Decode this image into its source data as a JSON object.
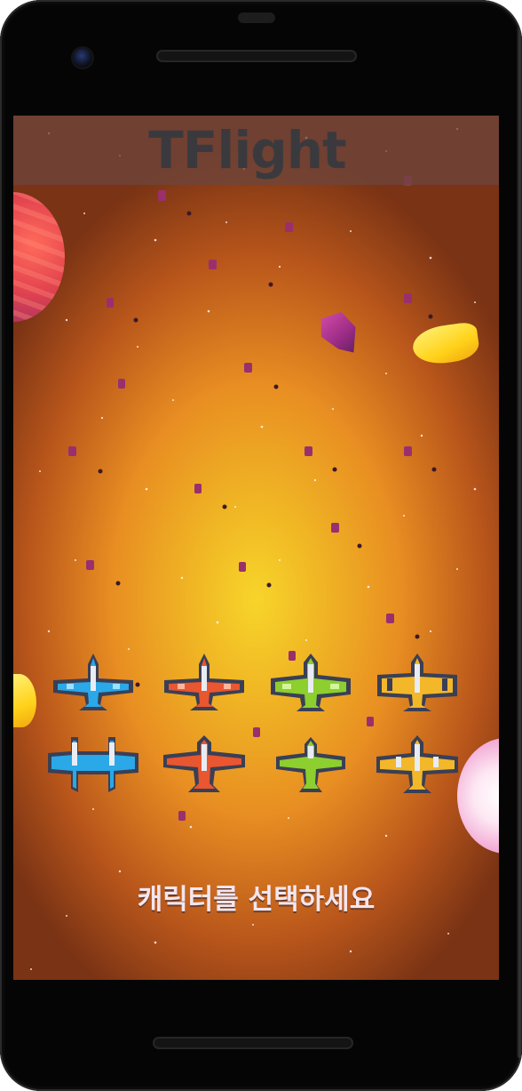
{
  "app": {
    "title": "TFlight"
  },
  "prompt": "캐릭터를 선택하세요",
  "characters": [
    {
      "name": "blue-jet",
      "color": "#2aa8e8"
    },
    {
      "name": "red-jet",
      "color": "#e9562f"
    },
    {
      "name": "green-jet",
      "color": "#8ccf2e"
    },
    {
      "name": "yellow-jet",
      "color": "#f3b72a"
    },
    {
      "name": "blue-twin",
      "color": "#2aa8e8"
    },
    {
      "name": "red-twin",
      "color": "#e9562f"
    },
    {
      "name": "green-small",
      "color": "#8ccf2e"
    },
    {
      "name": "yellow-twin",
      "color": "#f3b72a"
    }
  ],
  "colors": {
    "title_bar": "#6e463c",
    "background_center": "#f7d52a",
    "background_edge": "#7a3314",
    "outline": "#3a3f55"
  }
}
